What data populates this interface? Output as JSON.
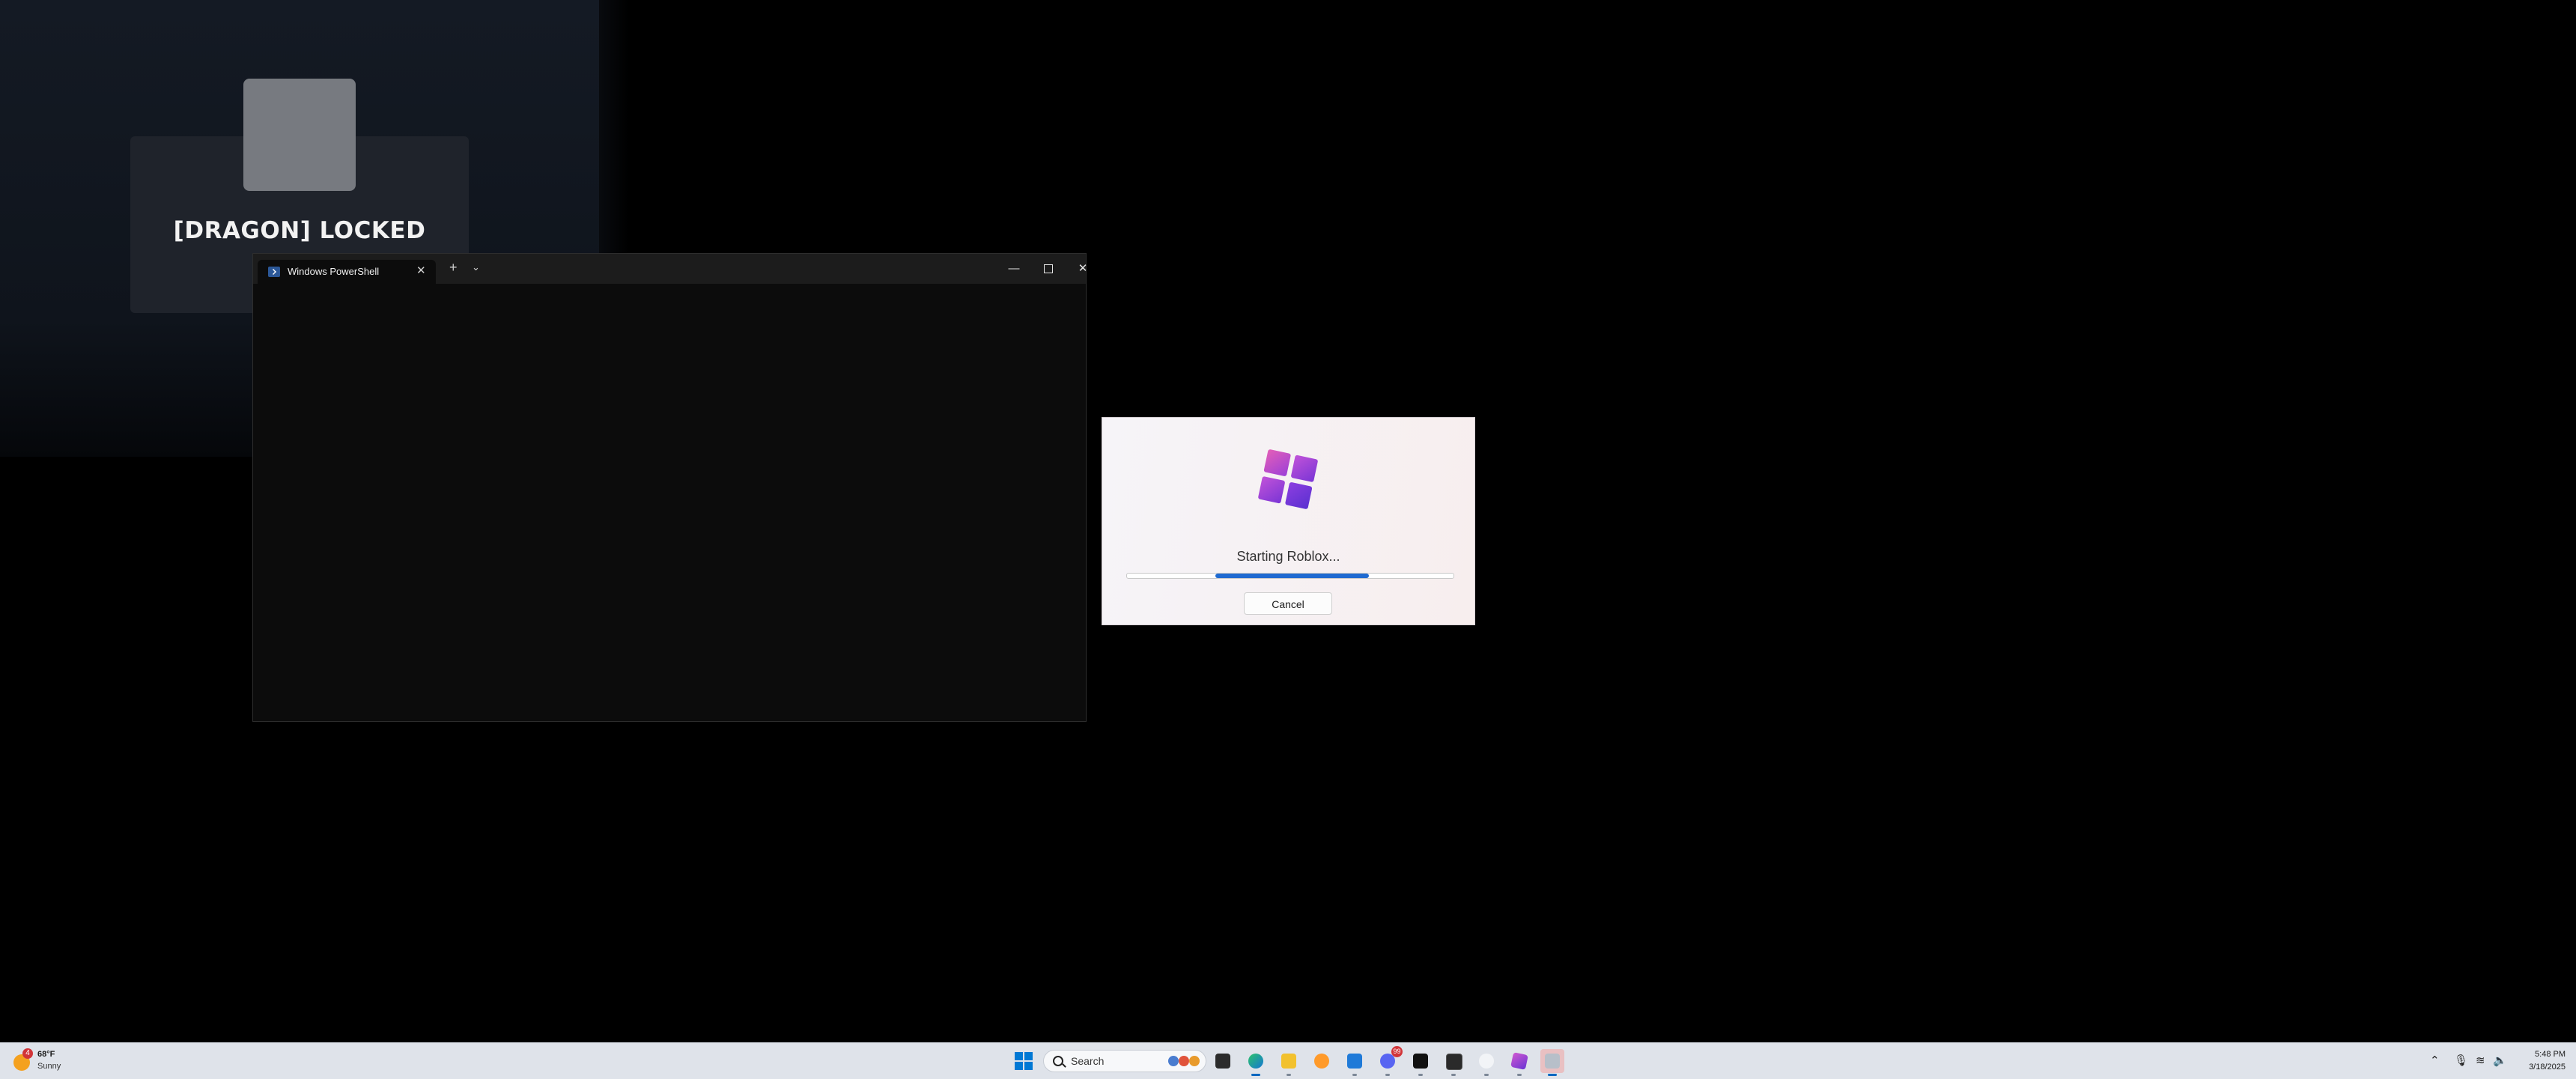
{
  "background": {
    "lock_text": "[DRAGON] LOCKED"
  },
  "terminal": {
    "tab_title": "Windows PowerShell",
    "tab_close_icon": "close-icon",
    "new_tab_icon": "plus-icon",
    "dropdown_icon": "chevron-down-icon",
    "minimize_icon": "minimize-icon",
    "maximize_icon": "maximize-icon",
    "close_icon": "close-icon"
  },
  "launcher": {
    "status_text": "Starting Roblox...",
    "progress": {
      "start": 0.27,
      "end": 0.74
    },
    "cancel_label": "Cancel",
    "accent_color": "#1f6ad1"
  },
  "taskbar": {
    "weather": {
      "temp": "68°F",
      "condition": "Sunny",
      "badge": "4"
    },
    "search_placeholder": "Search",
    "apps": [
      {
        "name": "edge-icon",
        "active": true
      },
      {
        "name": "file-explorer-icon",
        "active": false
      },
      {
        "name": "browser-icon",
        "active": false
      },
      {
        "name": "photos-icon",
        "active": false
      },
      {
        "name": "discord-icon",
        "active": false,
        "badge": "99"
      },
      {
        "name": "capcut-icon",
        "active": false
      },
      {
        "name": "terminal-icon",
        "active": false
      },
      {
        "name": "cloud-icon",
        "active": false
      },
      {
        "name": "roblox-icon",
        "active": false
      },
      {
        "name": "roblox-installer-icon",
        "active": true
      }
    ],
    "clock": {
      "time": "5:48 PM",
      "date": "3/18/2025"
    }
  }
}
